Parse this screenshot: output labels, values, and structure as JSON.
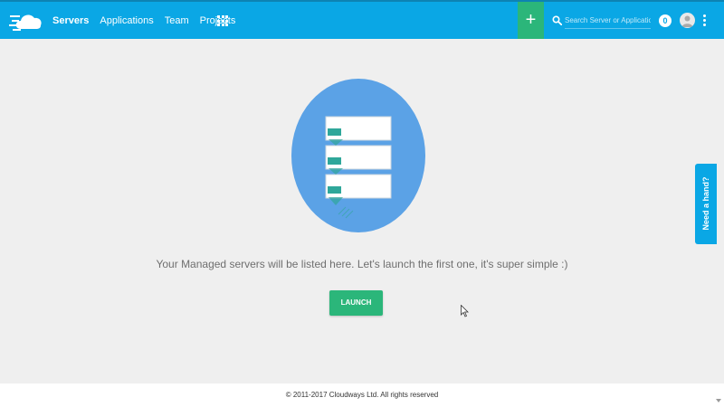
{
  "header": {
    "nav": [
      "Servers",
      "Applications",
      "Team",
      "Projects"
    ],
    "search_placeholder": "Search Server or Application",
    "notification_count": "0",
    "add_label": "+"
  },
  "main": {
    "message": "Your Managed servers will be listed here. Let's launch the first one, it's super simple :)",
    "launch_label": "LAUNCH"
  },
  "help_tab": "Need a hand?",
  "footer": "© 2011-2017 Cloudways Ltd. All rights reserved",
  "colors": {
    "brand_blue": "#0aa7e5",
    "green": "#2bb67a",
    "background": "#efefef"
  },
  "icons": [
    "cloudways-logo",
    "apps-grid-icon",
    "plus-icon",
    "search-icon",
    "user-avatar-icon",
    "kebab-menu-icon",
    "server-stack-illustration",
    "mouse-cursor-icon"
  ]
}
